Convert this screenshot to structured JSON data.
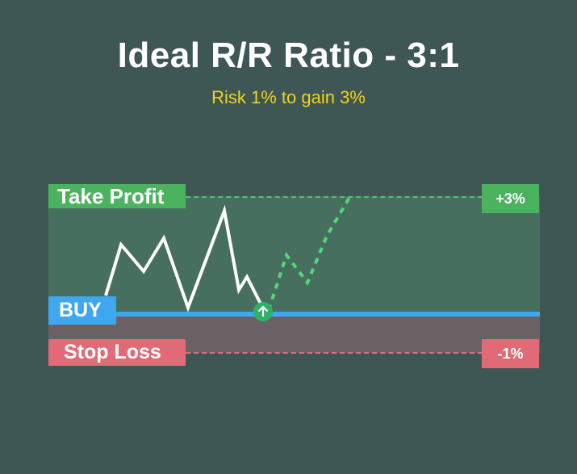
{
  "title": "Ideal R/R Ratio - 3:1",
  "subtitle": "Risk 1% to gain 3%",
  "labels": {
    "take_profit": "Take Profit",
    "buy": "BUY",
    "stop_loss": "Stop Loss"
  },
  "badges": {
    "take_profit": "+3%",
    "stop_loss": "-1%"
  },
  "colors": {
    "background": "#3f5754",
    "title": "#ffffff",
    "subtitle": "#f2d21b",
    "take_profit": "#4bb35f",
    "buy": "#3fa7f0",
    "stop_loss": "#e06b76",
    "price_path": "#ffffff",
    "projected_path": "#55d977"
  },
  "icons": {
    "entry_marker": "arrow-up-circle-icon"
  }
}
